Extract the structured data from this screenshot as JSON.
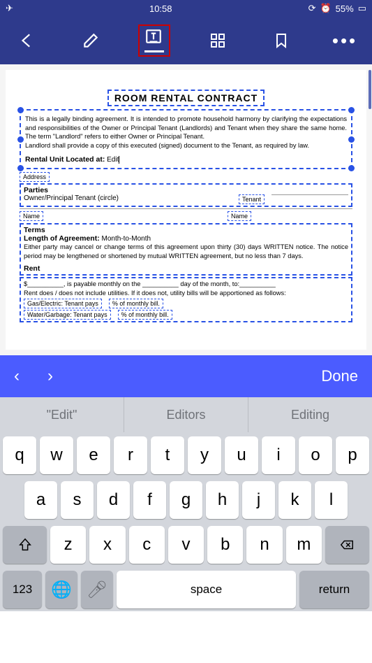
{
  "status": {
    "time": "10:58",
    "battery": "55%"
  },
  "doc": {
    "title": "ROOM RENTAL CONTRACT",
    "p1": "This is a legally binding agreement. It is intended to promote household harmony by clarifying the expectations and responsibilities of the Owner or Principal Tenant (Landlords) and Tenant when they share the same home. The term \"Landlord\" refers to either Owner or Principal Tenant.",
    "p2": "Landlord shall provide a copy of this executed (signed) document to the Tenant, as required by law.",
    "rental_label": "Rental Unit Located at:",
    "edit_value": "Edit",
    "address": "Address",
    "parties": "Parties",
    "owner": "Owner/Principal Tenant (circle)",
    "tenant": "Tenant",
    "name": "Name",
    "terms": "Terms",
    "length": "Length of Agreement:",
    "length_val": "Month-to-Month",
    "terms_p": "Either party may cancel or change terms of this agreement upon thirty (30) days WRITTEN notice. The notice period may be lengthened or shortened by mutual WRITTEN agreement, but no less than 7 days.",
    "rent": "Rent",
    "rent_line": "$__________, is payable monthly on the __________ day of the month, to:__________",
    "rent_incl": "Rent does / does not include utilities. If it does not, utility bills will be apportioned as follows:",
    "gas": "Gas/Electric: Tenant pays",
    "gas_pct": "% of monthly bill.",
    "water": "Water/Garbage: Tenant pays",
    "water_pct": "% of monthly bill."
  },
  "accessory": {
    "done": "Done"
  },
  "suggestions": [
    "\"Edit\"",
    "Editors",
    "Editing"
  ],
  "keys": {
    "r1": [
      "q",
      "w",
      "e",
      "r",
      "t",
      "y",
      "u",
      "i",
      "o",
      "p"
    ],
    "r2": [
      "a",
      "s",
      "d",
      "f",
      "g",
      "h",
      "j",
      "k",
      "l"
    ],
    "r3": [
      "z",
      "x",
      "c",
      "v",
      "b",
      "n",
      "m"
    ],
    "num": "123",
    "space": "space",
    "ret": "return"
  }
}
